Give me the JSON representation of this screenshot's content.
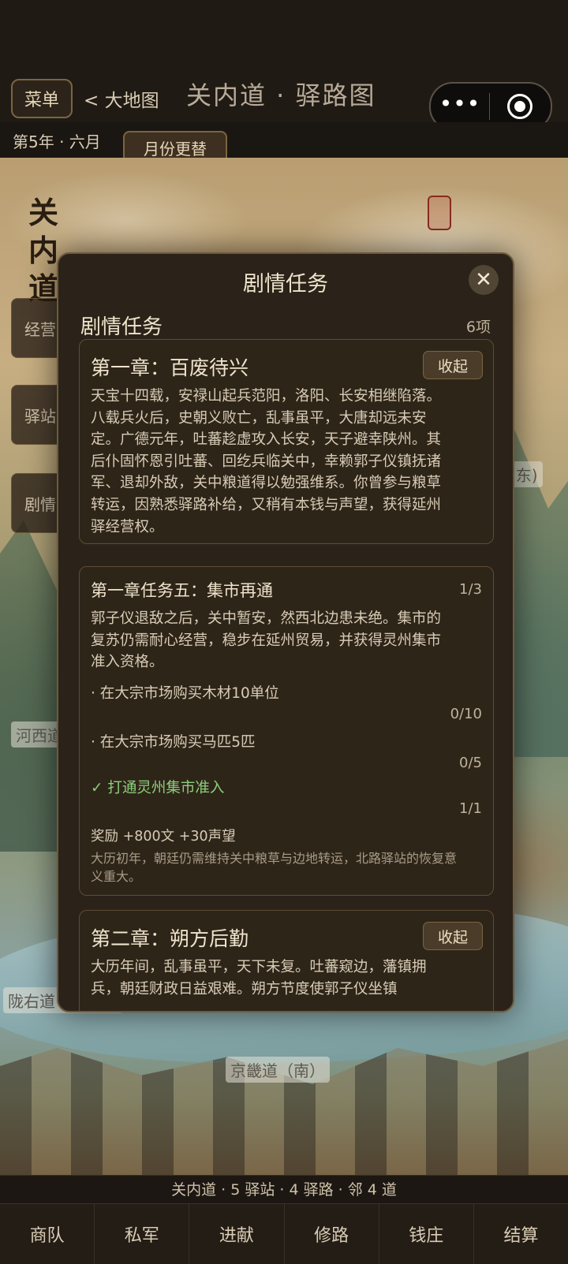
{
  "header": {
    "menu_label": "菜单",
    "back_label": "< 大地图",
    "title": "关内道 · 驿路图",
    "date": "第5年 · 六月",
    "month_button": "月份更替"
  },
  "capsule": {
    "more": "•••"
  },
  "map": {
    "title": "关内道",
    "side_items": [
      "经营",
      "驿站",
      "剧情"
    ],
    "labels": {
      "east": "(东)",
      "west": "河西道",
      "southwest": "陇右道（西南）",
      "south": "京畿道（南）"
    }
  },
  "modal": {
    "title": "剧情任务",
    "close": "✕",
    "section_title": "剧情任务",
    "section_count": "6项",
    "cards": [
      {
        "title": "第一章：百废待兴",
        "button": "收起",
        "body": "天宝十四载，安禄山起兵范阳，洛阳、长安相继陷落。八载兵火后，史朝义败亡，乱事虽平，大唐却远未安定。广德元年，吐蕃趁虚攻入长安，天子避幸陕州。其后仆固怀恩引吐蕃、回纥兵临关中，幸赖郭子仪镇抚诸军、退却外敌，关中粮道得以勉强维系。你曾参与粮草转运，因熟悉驿路补给，又稍有本钱与声望，获得延州驿经营权。"
      },
      {
        "title": "第一章任务五：集市再通",
        "progress": "1/3",
        "body": "郭子仪退敌之后，关中暂安，然西北边患未绝。集市的复苏仍需耐心经营，稳步在延州贸易，并获得灵州集市准入资格。",
        "objectives": [
          {
            "text": "· 在大宗市场购买木材10单位",
            "progress": "0/10",
            "done": false
          },
          {
            "text": "· 在大宗市场购买马匹5匹",
            "progress": "0/5",
            "done": false
          },
          {
            "text": "✓ 打通灵州集市准入",
            "progress": "1/1",
            "done": true
          }
        ],
        "reward": "奖励 +800文 +30声望",
        "note": "大历初年，朝廷仍需维持关中粮草与边地转运，北路驿站的恢复意义重大。"
      },
      {
        "title": "第二章：朔方后勤",
        "button": "收起",
        "body": "大历年间，乱事虽平，天下未复。吐蕃窥边，藩镇拥兵，朝廷财政日益艰难。朔方节度使郭子仪坐镇"
      }
    ]
  },
  "status": "关内道 · 5 驿站 · 4 驿路 · 邻 4 道",
  "nav": [
    "商队",
    "私军",
    "进献",
    "修路",
    "钱庄",
    "结算"
  ]
}
